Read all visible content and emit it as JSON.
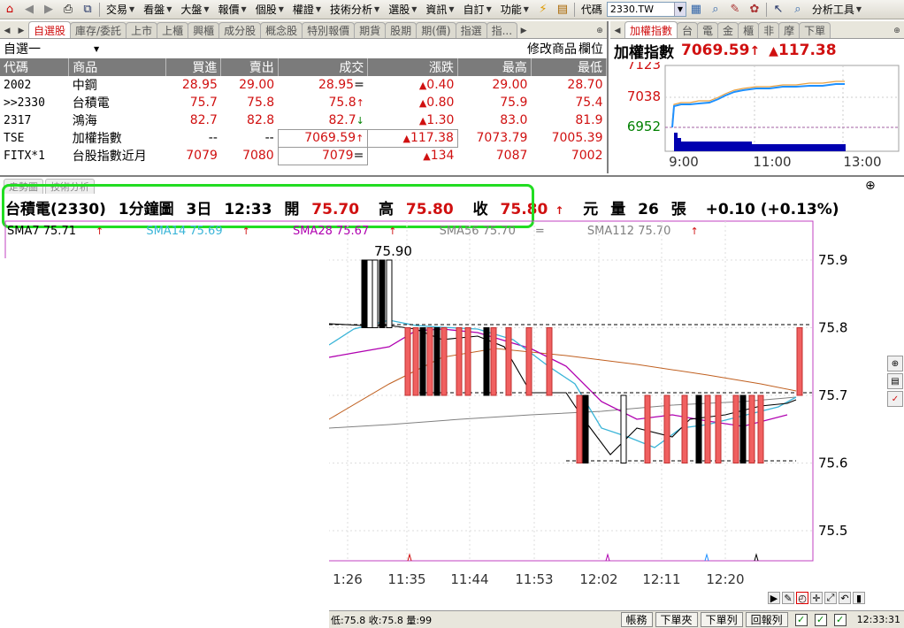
{
  "toolbar": {
    "menus": [
      "交易",
      "看盤",
      "大盤",
      "報價",
      "個股",
      "權證",
      "技術分析",
      "選股",
      "資訊",
      "自訂",
      "功能"
    ],
    "code_label": "代碼",
    "code_value": "2330.TW",
    "analysis_tools": "分析工具"
  },
  "watchlist": {
    "tabs": [
      "自選股",
      "庫存/委託",
      "上市",
      "上櫃",
      "興櫃",
      "成分股",
      "概念股",
      "特別報價",
      "期貨",
      "股期",
      "期(價)",
      "指選",
      "指..."
    ],
    "list_name": "自選一",
    "modify_label": "修改商品",
    "column_label": "欄位",
    "headers": [
      "代碼",
      "商品",
      "買進",
      "賣出",
      "成交",
      "漲跌",
      "最高",
      "最低"
    ],
    "rows": [
      {
        "code": "2002",
        "name": "中鋼",
        "bid": "28.95",
        "ask": "29.00",
        "last": "28.95",
        "last_mark": "=",
        "chg": "0.40",
        "chg_dir": "up",
        "high": "29.00",
        "low": "28.70"
      },
      {
        "code": ">>2330",
        "name": "台積電",
        "bid": "75.7",
        "ask": "75.8",
        "last": "75.8",
        "last_mark": "↑",
        "chg": "0.80",
        "chg_dir": "up",
        "high": "75.9",
        "low": "75.4"
      },
      {
        "code": "2317",
        "name": "鴻海",
        "bid": "82.7",
        "ask": "82.8",
        "last": "82.7",
        "last_mark": "↓",
        "chg": "1.30",
        "chg_dir": "up",
        "high": "83.0",
        "low": "81.9"
      },
      {
        "code": "TSE",
        "name": "加權指數",
        "bid": "--",
        "ask": "--",
        "last": "7069.59",
        "last_mark": "↑",
        "chg": "117.38",
        "chg_dir": "up",
        "high": "7073.79",
        "low": "7005.39"
      },
      {
        "code": "FITX*1",
        "name": "台股指數近月",
        "bid": "7079",
        "ask": "7080",
        "last": "7079",
        "last_mark": "=",
        "chg": "134",
        "chg_dir": "up",
        "high": "7087",
        "low": "7002"
      }
    ]
  },
  "index_panel": {
    "tabs": [
      "加權指數",
      "台",
      "電",
      "金",
      "櫃",
      "非",
      "摩",
      "下單"
    ],
    "title": "加權指數",
    "value": "7069.59",
    "change": "117.38",
    "y_labels": [
      "7123",
      "7038",
      "6952"
    ],
    "x_labels": [
      "9:00",
      "11:00",
      "13:00"
    ]
  },
  "chart": {
    "tabs": [
      "走勢圖",
      "技術分析"
    ],
    "symbol": "台積電(2330)",
    "interval": "1分鐘圖",
    "range": "3日",
    "time": "12:33",
    "open_label": "開",
    "open": "75.70",
    "high_label": "高",
    "high": "75.80",
    "close_label": "收",
    "close": "75.80",
    "unit": "元",
    "vol_label": "量",
    "vol": "26",
    "vol_unit": "張",
    "change": "+0.10 (+0.13%)",
    "sma": [
      {
        "label": "SMA7 75.71",
        "color": "#000000"
      },
      {
        "label": "SMA14 75.69",
        "color": "#3bb5d8"
      },
      {
        "label": "SMA28 75.67",
        "color": "#b000b0"
      },
      {
        "label": "SMA56 75.70",
        "color": "#808080"
      },
      {
        "label": "SMA112 75.70",
        "color": "#c06020"
      }
    ],
    "y_ticks": [
      "75.9",
      "75.8",
      "75.7",
      "75.6",
      "75.5"
    ],
    "x_ticks": [
      "1:26",
      "11:35",
      "11:44",
      "11:53",
      "12:02",
      "12:11",
      "12:20"
    ],
    "peak_label": "75.90"
  },
  "chart_data": {
    "type": "line",
    "y_axis_ticks": [
      75.5,
      75.6,
      75.7,
      75.8,
      75.9
    ],
    "x_axis_ticks": [
      "1:26",
      "11:35",
      "11:44",
      "11:53",
      "12:02",
      "12:11",
      "12:20"
    ],
    "ylim": [
      75.45,
      75.95
    ]
  },
  "statusbar": {
    "text": "低:75.8 收:75.8 量:99",
    "buttons": [
      "帳務",
      "下單夾",
      "下單列",
      "回報列"
    ],
    "time": "12:33:31"
  },
  "colors": {
    "up": "#d01010",
    "down": "#008000",
    "highlight": "#22dd22"
  }
}
